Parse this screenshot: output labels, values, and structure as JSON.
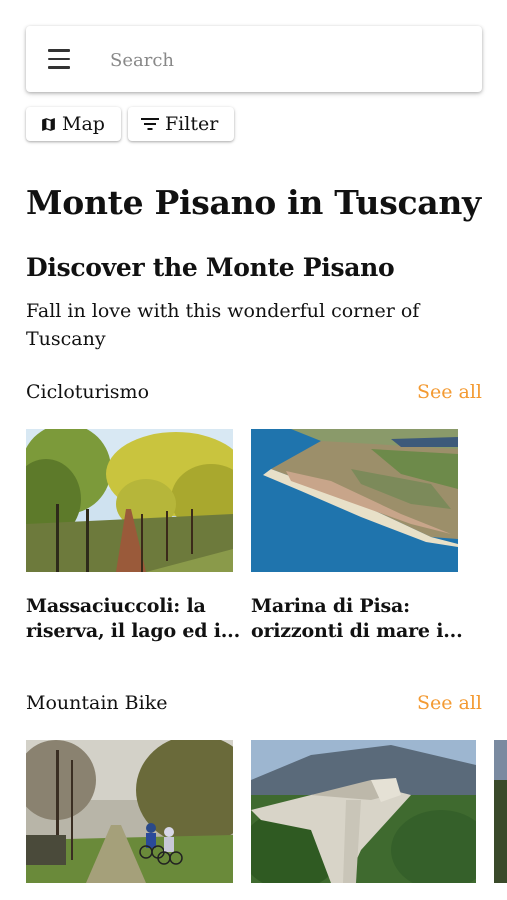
{
  "search": {
    "placeholder": "Search"
  },
  "chips": {
    "map": "Map",
    "filter": "Filter"
  },
  "page_title": "Monte Pisano in Tuscany",
  "section": {
    "title": "Discover the Monte Pisano",
    "description": "Fall in love with this wonderful corner of Tuscany"
  },
  "categories": [
    {
      "name": "Cicloturismo",
      "see_all": "See all",
      "cards": [
        {
          "title_line1": "Massaciuccoli: la",
          "title_line2": "riserva, il lago ed i..."
        },
        {
          "title_line1": "Marina di Pisa:",
          "title_line2": "orizzonti di mare i..."
        }
      ]
    },
    {
      "name": "Mountain Bike",
      "see_all": "See all",
      "cards": [
        {},
        {}
      ]
    }
  ],
  "colors": {
    "accent": "#f39a32"
  }
}
